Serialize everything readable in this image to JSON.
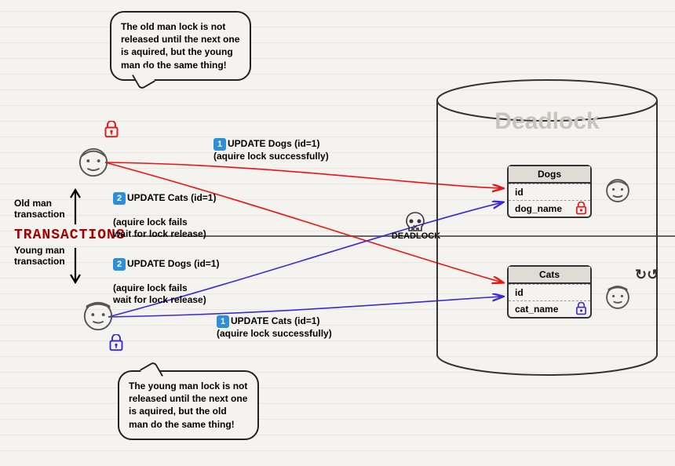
{
  "speechBubbles": {
    "top": "The old man lock is not released until the next one is aquired, but the young man do the same thing!",
    "bottom": "The young man lock is not released until the next one is aquired, but the old man do the same thing!"
  },
  "transactions": {
    "title": "TRANSACTIONS",
    "oldManLabel": "Old man\ntransaction",
    "youngManLabel": "Young man\ntransaction"
  },
  "queries": {
    "oldMan1": {
      "badge": "1",
      "text": "UPDATE Dogs (id=1)",
      "note": "(aquire lock successfully)"
    },
    "oldMan2": {
      "badge": "2",
      "text": "UPDATE Cats (id=1)",
      "note": "(aquire lock fails\nwait for lock release)"
    },
    "youngMan1": {
      "badge": "1",
      "text": "UPDATE Cats (id=1)",
      "note": "(aquire lock successfully)"
    },
    "youngMan2": {
      "badge": "2",
      "text": "UPDATE Dogs (id=1)",
      "note": "(aquire lock fails\nwait for lock release)"
    }
  },
  "deadlock": {
    "center": "DEADLOCK",
    "cylinder": "Deadlock"
  },
  "tables": {
    "dogs": {
      "name": "Dogs",
      "col1": "id",
      "col2": "dog_name"
    },
    "cats": {
      "name": "Cats",
      "col1": "id",
      "col2": "cat_name"
    }
  },
  "icons": {
    "redLock": "lock-icon-red",
    "purpleLock": "lock-icon-purple",
    "oldManFace": "old-man-face-icon",
    "youngManFace": "young-man-face-icon",
    "skull": "skull-icon",
    "refresh": "refresh-icon"
  },
  "colors": {
    "red": "#e11",
    "purple": "#3a2bd6",
    "brand": "#a30000"
  }
}
